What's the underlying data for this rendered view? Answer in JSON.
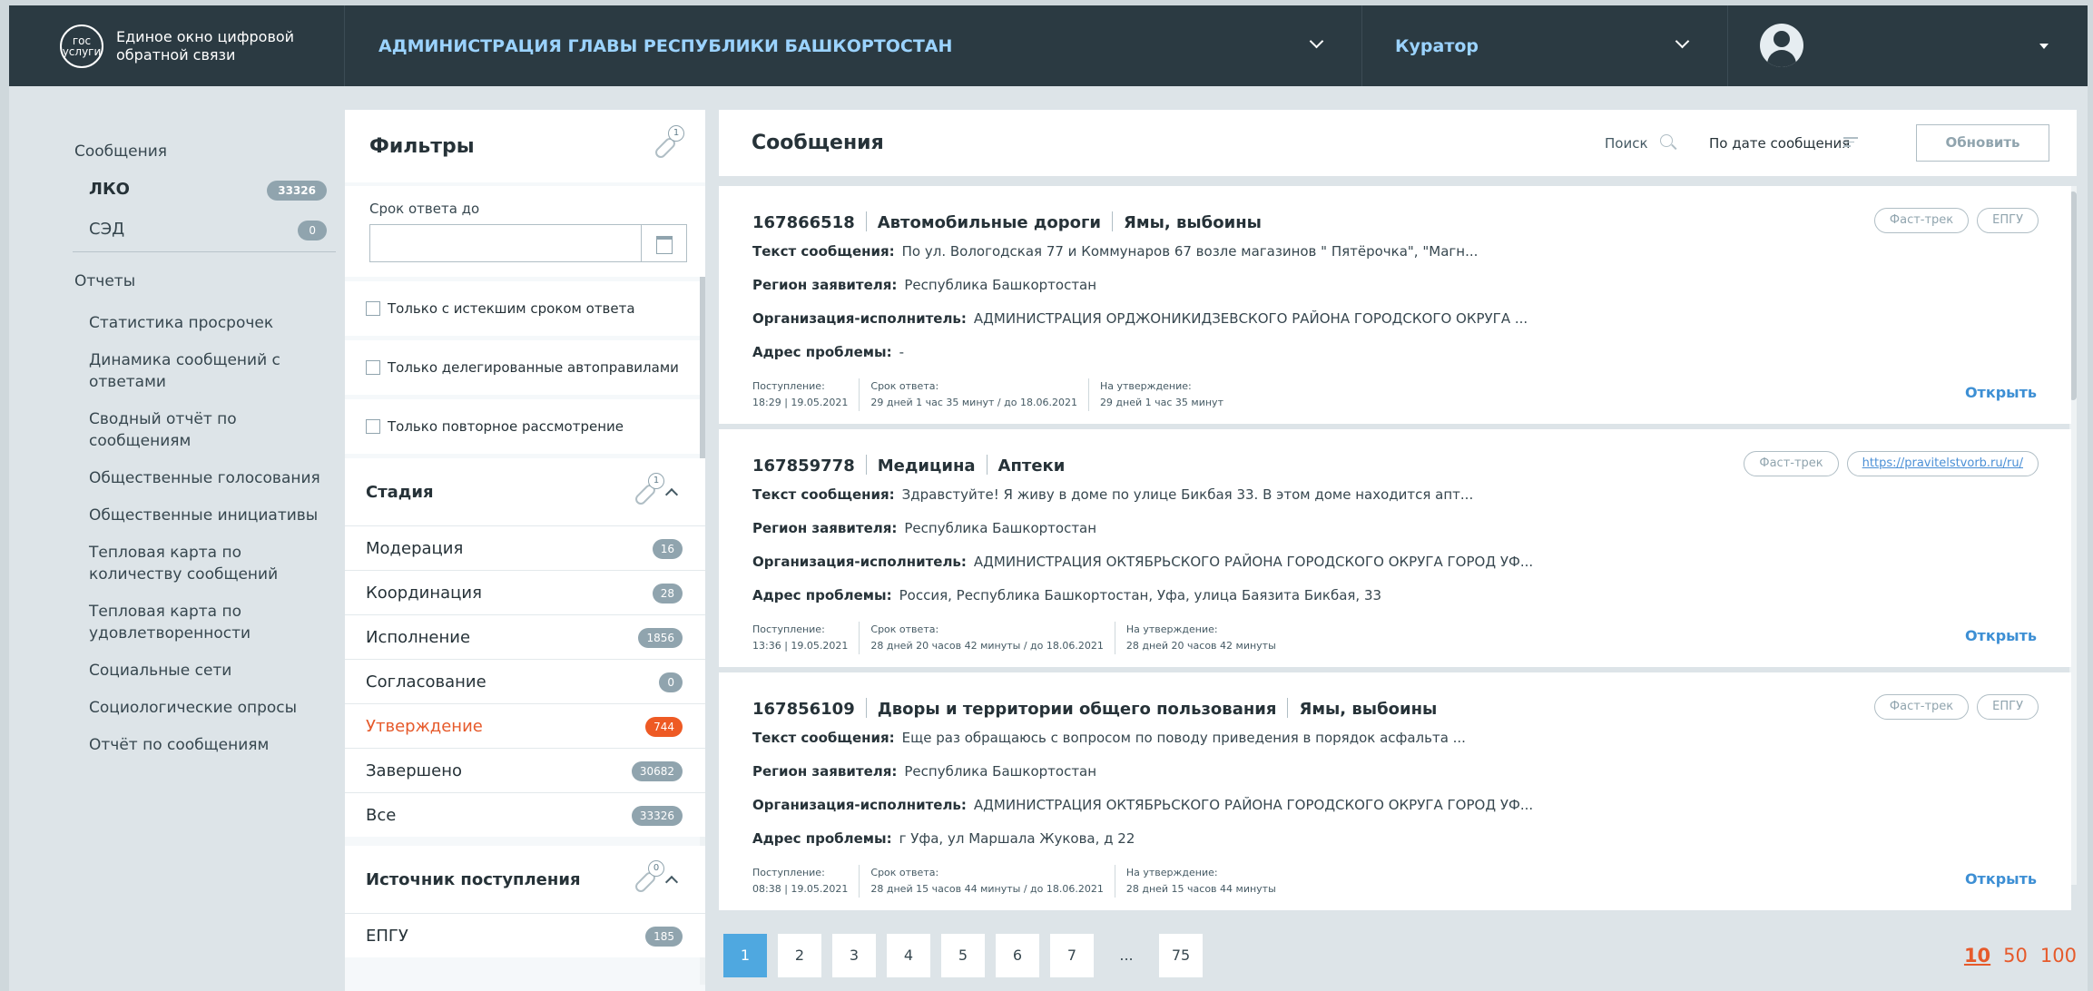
{
  "header": {
    "logo_badge": "гос услуги",
    "logo_text_line1": "Единое окно цифровой",
    "logo_text_line2": "обратной связи",
    "org_title": "АДМИНИСТРАЦИЯ ГЛАВЫ РЕСПУБЛИКИ БАШКОРТОСТАН",
    "role": "Куратор"
  },
  "nav": {
    "messages_label": "Сообщения",
    "items": [
      {
        "label": "ЛКО",
        "count": "33326"
      },
      {
        "label": "СЭД",
        "count": "0"
      }
    ],
    "reports_label": "Отчеты",
    "reports": [
      "Статистика просрочек",
      "Динамика сообщений с ответами",
      "Сводный отчёт по сообщениям",
      "Общественные голосования",
      "Общественные инициативы",
      "Тепловая карта по количеству сообщений",
      "Тепловая карта по удовлетворенности",
      "Социальные сети",
      "Социологические опросы",
      "Отчёт по сообщениям"
    ]
  },
  "filters": {
    "title": "Фильтры",
    "pin_count": "1",
    "date_label": "Срок ответа до",
    "date_value": "",
    "checks": [
      "Только с истекшим сроком ответа",
      "Только делегированные автоправилами",
      "Только повторное рассмотрение"
    ],
    "stage_title": "Стадия",
    "stage_pin_count": "1",
    "stages": [
      {
        "label": "Модерация",
        "count": "16"
      },
      {
        "label": "Координация",
        "count": "28"
      },
      {
        "label": "Исполнение",
        "count": "1856"
      },
      {
        "label": "Согласование",
        "count": "0"
      },
      {
        "label": "Утверждение",
        "count": "744"
      },
      {
        "label": "Завершено",
        "count": "30682"
      },
      {
        "label": "Все",
        "count": "33326"
      }
    ],
    "source_title": "Источник поступления",
    "source_pin_count": "0",
    "sources": [
      {
        "label": "ЕПГУ",
        "count": "185"
      }
    ]
  },
  "main": {
    "title": "Сообщения",
    "search_label": "Поиск",
    "sort_label": "По дате сообщения",
    "refresh_label": "Обновить",
    "field_labels": {
      "text": "Текст сообщения:",
      "region": "Регион заявителя:",
      "org": "Организация-исполнитель:",
      "address": "Адрес проблемы:",
      "received": "Поступление:",
      "deadline": "Срок ответа:",
      "approval": "На утверждение:"
    },
    "open_label": "Открыть",
    "messages": [
      {
        "id": "167866518",
        "category": "Автомобильные дороги",
        "subcategory": "Ямы, выбоины",
        "tag1": "Фаст-трек",
        "tag2": "ЕПГУ",
        "text": "По ул. Вологодская 77 и Коммунаров 67 возле магазинов \" Пятёрочка\", \"Магн...",
        "region": "Республика Башкортостан",
        "org": "АДМИНИСТРАЦИЯ ОРДЖОНИКИДЗЕВСКОГО РАЙОНА ГОРОДСКОГО ОКРУГА ...",
        "address": "-",
        "received": "18:29 | 19.05.2021",
        "deadline": "29 дней 1 час 35 минут / до 18.06.2021",
        "approval": "29 дней 1 час 35 минут"
      },
      {
        "id": "167859778",
        "category": "Медицина",
        "subcategory": "Аптеки",
        "tag1": "Фаст-трек",
        "tag2": "https://pravitelstvorb.ru/ru/",
        "text": "Здравстуйте! Я живу в доме по улице Бикбая 33. В этом доме находится апт...",
        "region": "Республика Башкортостан",
        "org": "АДМИНИСТРАЦИЯ ОКТЯБРЬСКОГО РАЙОНА ГОРОДСКОГО ОКРУГА ГОРОД УФ...",
        "address": "Россия, Республика Башкортостан, Уфа, улица Баязита Бикбая, 33",
        "received": "13:36 | 19.05.2021",
        "deadline": "28 дней 20 часов 42 минуты / до 18.06.2021",
        "approval": "28 дней 20 часов 42 минуты"
      },
      {
        "id": "167856109",
        "category": "Дворы и территории общего пользования",
        "subcategory": "Ямы, выбоины",
        "tag1": "Фаст-трек",
        "tag2": "ЕПГУ",
        "text": "Еще раз обращаюсь с вопросом по поводу приведения в порядок асфальта ...",
        "region": "Республика Башкортостан",
        "org": "АДМИНИСТРАЦИЯ ОКТЯБРЬСКОГО РАЙОНА ГОРОДСКОГО ОКРУГА ГОРОД УФ...",
        "address": "г Уфа, ул Маршала Жукова, д 22",
        "received": "08:38 | 19.05.2021",
        "deadline": "28 дней 15 часов 44 минуты / до 18.06.2021",
        "approval": "28 дней 15 часов 44 минуты"
      }
    ],
    "pages": [
      "1",
      "2",
      "3",
      "4",
      "5",
      "6",
      "7",
      "...",
      "75"
    ],
    "per_page": [
      "10",
      "50",
      "100"
    ]
  }
}
